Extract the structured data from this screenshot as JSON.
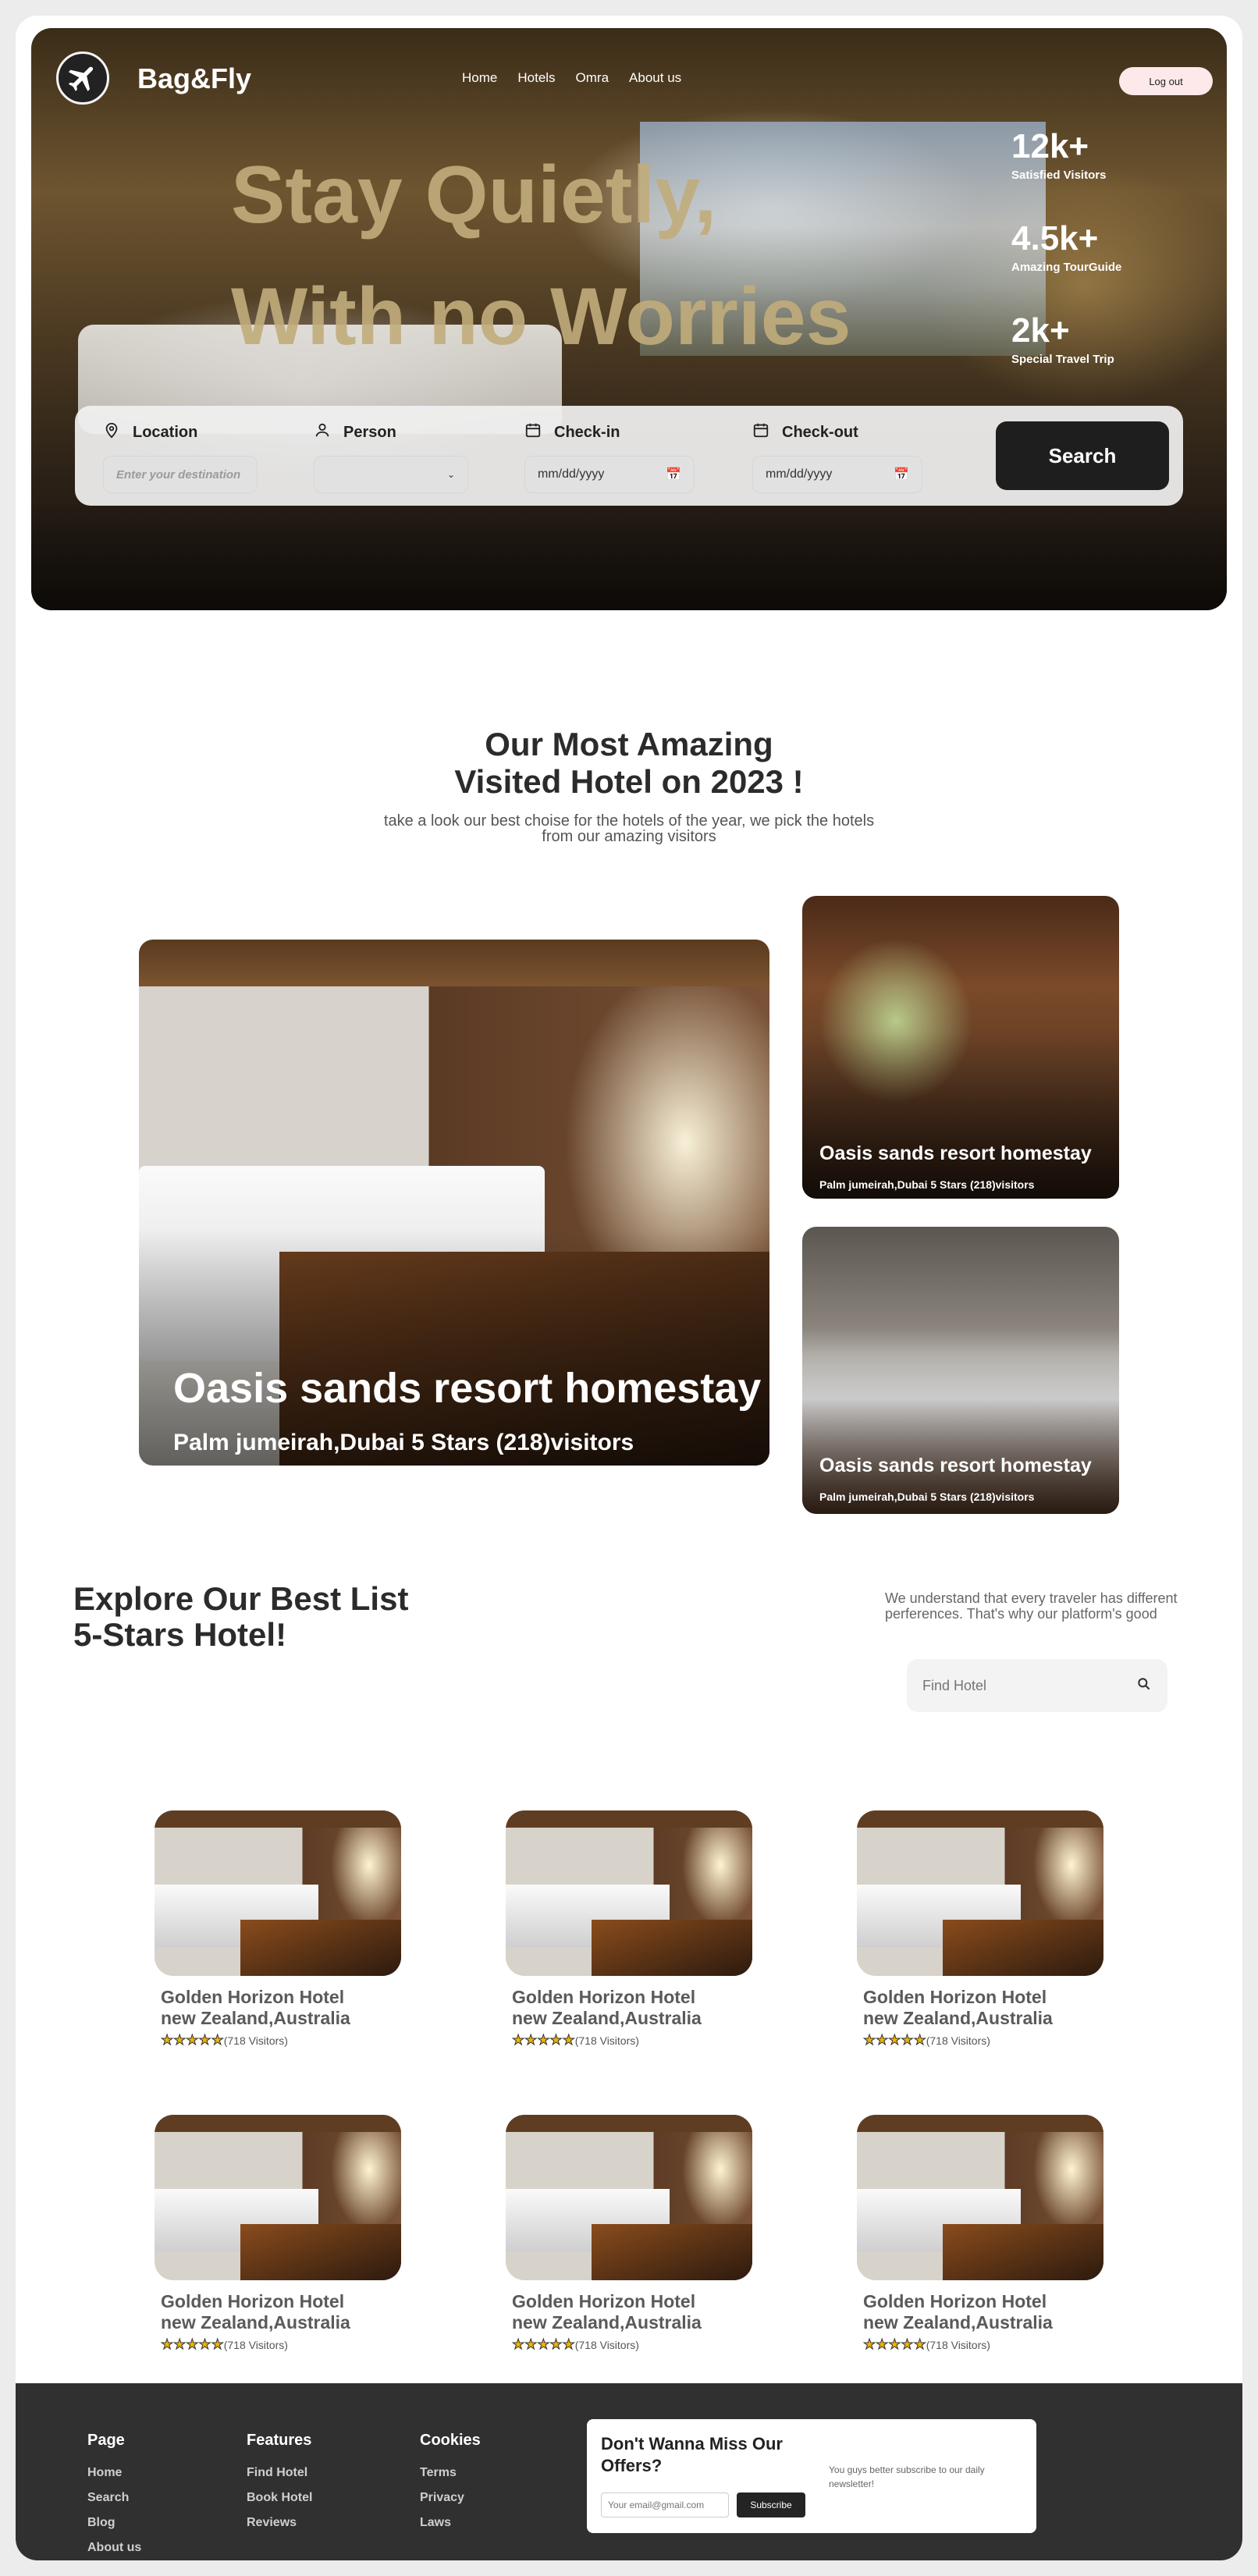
{
  "header": {
    "brand": "Bag&Fly",
    "nav": [
      "Home",
      "Hotels",
      "Omra",
      "About us"
    ],
    "logout_label": "Log out"
  },
  "hero": {
    "headline_line1": "Stay Quietly,",
    "headline_line2": "With no Worries",
    "stats": [
      {
        "value": "12k+",
        "label": "Satisfied Visitors"
      },
      {
        "value": "4.5k+",
        "label": "Amazing TourGuide"
      },
      {
        "value": "2k+",
        "label": "Special Travel Trip"
      }
    ]
  },
  "search": {
    "location_label": "Location",
    "location_placeholder": "Enter your destination",
    "person_label": "Person",
    "checkin_label": "Check-in",
    "checkin_value": "mm/dd/yyyy",
    "checkout_label": "Check-out",
    "checkout_value": "mm/dd/yyyy",
    "button_label": "Search"
  },
  "featured": {
    "title_line1": "Our Most Amazing",
    "title_line2": "Visited Hotel on 2023 !",
    "subtitle_line1": "take a look our best choise for the hotels of the year, we pick the hotels",
    "subtitle_line2": "from our amazing visitors",
    "cards": [
      {
        "name": "Oasis sands resort homestay",
        "meta": "Palm jumeirah,Dubai  5 Stars (218)visitors"
      },
      {
        "name": "Oasis sands resort homestay",
        "meta": "Palm jumeirah,Dubai  5 Stars (218)visitors"
      },
      {
        "name": "Oasis sands resort homestay",
        "meta": "Palm jumeirah,Dubai  5 Stars (218)visitors"
      }
    ]
  },
  "explore": {
    "title_line1": "Explore Our Best List",
    "title_line2": "5-Stars Hotel!",
    "description": "We understand that every traveler has different perferences. That's why our platform's good",
    "search_placeholder": "Find Hotel",
    "hotels": [
      {
        "name": "Golden Horizon Hotel",
        "location": "new Zealand,Australia",
        "stars": 5,
        "visitors": "(718 Visitors)"
      },
      {
        "name": "Golden Horizon Hotel",
        "location": "new Zealand,Australia",
        "stars": 5,
        "visitors": "(718 Visitors)"
      },
      {
        "name": "Golden Horizon Hotel",
        "location": "new Zealand,Australia",
        "stars": 5,
        "visitors": "(718 Visitors)"
      },
      {
        "name": "Golden Horizon Hotel",
        "location": "new Zealand,Australia",
        "stars": 5,
        "visitors": "(718 Visitors)"
      },
      {
        "name": "Golden Horizon Hotel",
        "location": "new Zealand,Australia",
        "stars": 5,
        "visitors": "(718 Visitors)"
      },
      {
        "name": "Golden Horizon Hotel",
        "location": "new Zealand,Australia",
        "stars": 5,
        "visitors": "(718 Visitors)"
      }
    ]
  },
  "footer": {
    "page": {
      "title": "Page",
      "links": [
        "Home",
        "Search",
        "Blog",
        "About us"
      ]
    },
    "features": {
      "title": "Features",
      "links": [
        "Find Hotel",
        "Book Hotel",
        "Reviews"
      ]
    },
    "cookies": {
      "title": "Cookies",
      "links": [
        "Terms",
        "Privacy",
        "Laws"
      ]
    },
    "newsletter": {
      "title": "Don't Wanna Miss Our Offers?",
      "description": "You guys better subscribe to our daily newsletter!",
      "email_placeholder": "Your email@gmail.com",
      "button_label": "Subscribe"
    }
  }
}
